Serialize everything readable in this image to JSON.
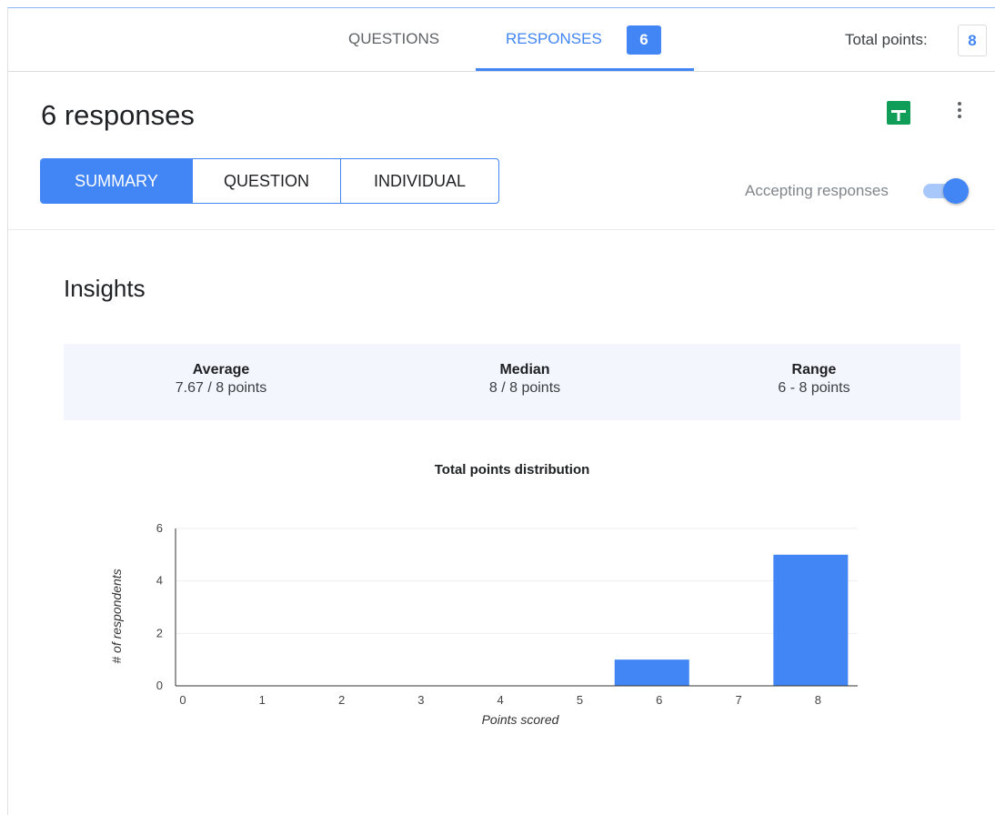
{
  "tabs": {
    "questions": "QUESTIONS",
    "responses": "RESPONSES",
    "responses_count": "6",
    "total_points_label": "Total points:",
    "total_points_value": "8"
  },
  "header": {
    "title": "6 responses",
    "accepting_label": "Accepting responses",
    "accepting_on": true
  },
  "view_tabs": [
    "SUMMARY",
    "QUESTION",
    "INDIVIDUAL"
  ],
  "insights": {
    "title": "Insights",
    "stats": [
      {
        "label": "Average",
        "value": "7.67 / 8 points"
      },
      {
        "label": "Median",
        "value": "8 / 8 points"
      },
      {
        "label": "Range",
        "value": "6 - 8 points"
      }
    ]
  },
  "icons": {
    "sheets": "google-sheets-icon",
    "more": "more-vert-icon"
  },
  "colors": {
    "accent": "#4285f4",
    "sheets_green": "#0f9d58",
    "stats_bg": "#f3f6fc"
  },
  "chart_data": {
    "type": "bar",
    "title": "Total points distribution",
    "xlabel": "Points scored",
    "ylabel": "# of respondents",
    "categories": [
      "0",
      "1",
      "2",
      "3",
      "4",
      "5",
      "6",
      "7",
      "8"
    ],
    "values": [
      0,
      0,
      0,
      0,
      0,
      0,
      1,
      0,
      5
    ],
    "yticks": [
      0,
      2,
      4,
      6
    ],
    "ylim": [
      0,
      6
    ],
    "grid": true,
    "bar_color": "#4285f4"
  }
}
